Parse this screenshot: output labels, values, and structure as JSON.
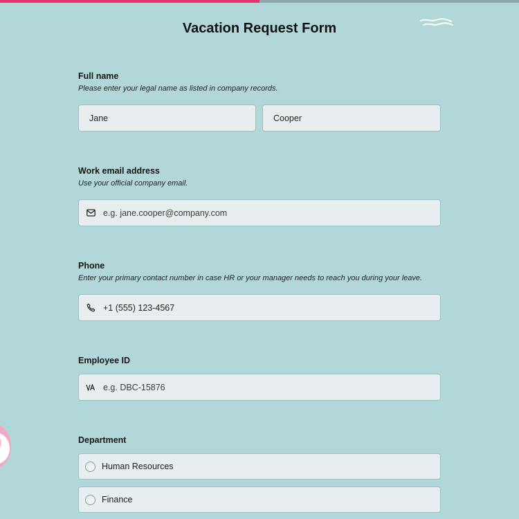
{
  "progress": {
    "fraction": 0.5,
    "fill_color": "#e8336e",
    "track_color": "#8fa8ab"
  },
  "background_color": "#b2d7d8",
  "form": {
    "title": "Vacation Request Form"
  },
  "full_name": {
    "label": "Full name",
    "help": "Please enter your legal name as listed in company records.",
    "first_value": "Jane",
    "last_value": "Cooper"
  },
  "email": {
    "label": "Work email address",
    "help": "Use your official company email.",
    "placeholder": "e.g. jane.cooper@company.com",
    "icon": "envelope-icon"
  },
  "phone": {
    "label": "Phone",
    "help": "Enter your primary contact number in case HR or your manager needs to reach you during your leave.",
    "value": "+1 (555) 123-4567",
    "icon": "phone-icon"
  },
  "employee_id": {
    "label": "Employee ID",
    "placeholder": "e.g. DBC-15876",
    "icon": "id-text-icon"
  },
  "department": {
    "label": "Department",
    "options": [
      "Human Resources",
      "Finance"
    ]
  }
}
